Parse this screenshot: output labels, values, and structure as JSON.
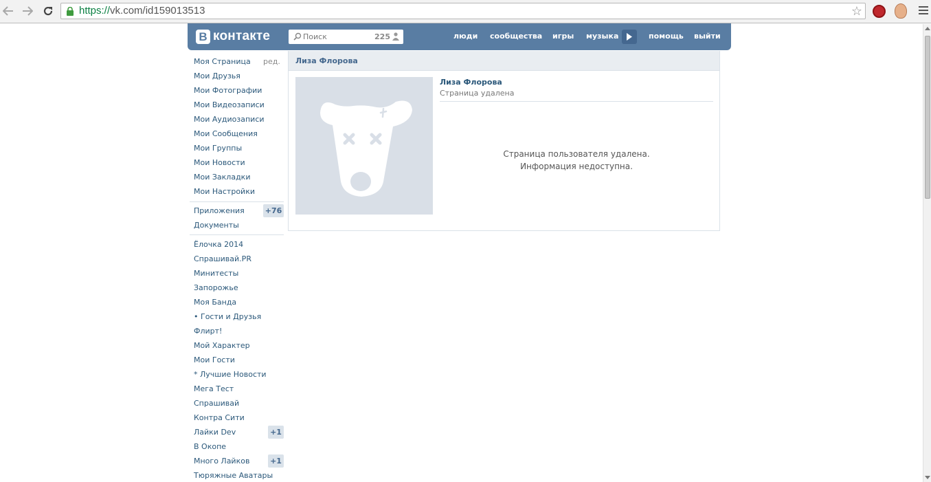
{
  "browser": {
    "url_scheme": "https://",
    "url_rest": "vk.com/id159013513"
  },
  "header": {
    "logo_letter": "В",
    "logo_text": "контакте",
    "search_placeholder": "Поиск",
    "search_count": "225",
    "nav": [
      "люди",
      "сообщества",
      "игры",
      "музыка",
      "помощь",
      "выйти"
    ]
  },
  "sidebar": {
    "edit_label": "ред.",
    "main_items": [
      "Моя Страница",
      "Мои Друзья",
      "Мои Фотографии",
      "Мои Видеозаписи",
      "Мои Аудиозаписи",
      "Мои Сообщения",
      "Мои Группы",
      "Мои Новости",
      "Мои Закладки",
      "Мои Настройки"
    ],
    "apps_label": "Приложения",
    "apps_badge": "+76",
    "docs_label": "Документы",
    "app_items": [
      "Ёлочка 2014",
      "Спрашивай.PR",
      "Минитесты",
      "Запорожье",
      "Моя Банда",
      "• Гости и Друзья",
      "Флирт!",
      "Мой Характер",
      "Мои Гости",
      "* Лучшие Новости",
      "Мега Тест",
      "Спрашивай",
      "Контра Сити",
      "Лайки Dev",
      "В Окопе",
      "Много Лайков",
      "Тюряжные Аватары"
    ],
    "app_badges": {
      "Лайки Dev": "+1",
      "Много Лайков": "+1"
    }
  },
  "profile": {
    "header_name": "Лиза Флорова",
    "name": "Лиза Флорова",
    "status": "Страница удалена",
    "message_line1": "Страница пользователя удалена.",
    "message_line2": "Информация недоступна."
  },
  "colors": {
    "header_bg": "#597da3",
    "link": "#2b587a",
    "badge_bg": "#dae2ea",
    "avatar_bg": "#d9dfe7"
  }
}
